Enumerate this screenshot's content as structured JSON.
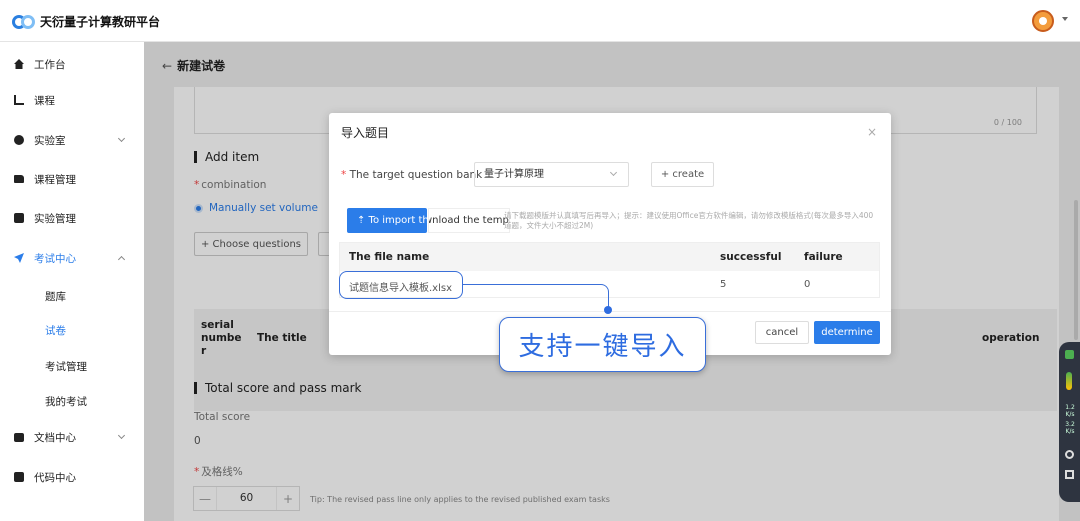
{
  "app": {
    "title": "天衍量子计算教研平台"
  },
  "sidebar": {
    "items": [
      {
        "label": "工作台"
      },
      {
        "label": "课程"
      },
      {
        "label": "实验室"
      },
      {
        "label": "课程管理"
      },
      {
        "label": "实验管理"
      },
      {
        "label": "考试中心"
      },
      {
        "label": "文档中心"
      },
      {
        "label": "代码中心"
      }
    ],
    "exam_sub": [
      {
        "label": "题库"
      },
      {
        "label": "试卷"
      },
      {
        "label": "考试管理"
      },
      {
        "label": "我的考试"
      }
    ]
  },
  "page": {
    "back": "←",
    "title": "新建试卷",
    "counter": "0 / 100",
    "add_item": "Add item",
    "combination": "combination",
    "manual": "Manually set volume",
    "choose": "+ Choose questions",
    "table_cols": {
      "serial": "serial numbe r",
      "title": "The title",
      "operation": "operation"
    },
    "total_section": "Total score and pass mark",
    "total_score_label": "Total score",
    "total_score_value": "0",
    "pass_label": "及格线%",
    "pass_value": "60",
    "minus": "—",
    "plus": "+",
    "pass_tip": "Tip: The revised pass line only applies to the revised published exam tasks"
  },
  "modal": {
    "title": "导入题目",
    "close": "×",
    "bank_label": "The target question bank",
    "bank_value": "量子计算原理",
    "create": "+ create",
    "import_btn": "⇡ To import th",
    "download": "Download the template",
    "hint": "请下载题模版并认真填写后再导入；提示：建议使用Office官方软件编辑，请勿修改模版格式(每次最多导入400道题，文件大小不超过2M)",
    "cols": {
      "file": "The file name",
      "success": "successful",
      "failure": "failure"
    },
    "row": {
      "file": "试题信息导入模板.xlsx",
      "success": "5",
      "failure": "0"
    },
    "cancel": "cancel",
    "determine": "determine"
  },
  "callout": {
    "text": "支持一键导入"
  },
  "float_tool": {
    "up": "1.2",
    "down": "3.2",
    "unit": "K/s"
  }
}
